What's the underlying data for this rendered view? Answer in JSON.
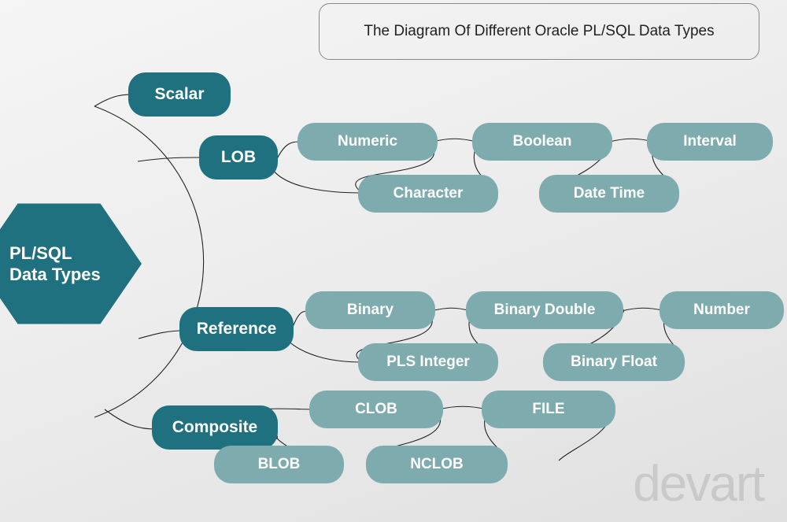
{
  "title": "The Diagram Of Different Oracle PL/SQL Data Types",
  "root": "PL/SQL\nData Types",
  "categories": {
    "scalar": "Scalar",
    "lob": "LOB",
    "reference": "Reference",
    "composite": "Composite"
  },
  "group1": {
    "numeric": "Numeric",
    "boolean": "Boolean",
    "interval": "Interval",
    "character": "Character",
    "datetime": "Date Time"
  },
  "group2": {
    "binary": "Binary",
    "binary_double": "Binary Double",
    "number": "Number",
    "pls_integer": "PLS Integer",
    "binary_float": "Binary Float"
  },
  "group3": {
    "clob": "CLOB",
    "file": "FILE",
    "blob": "BLOB",
    "nclob": "NCLOB"
  },
  "watermark": "devart"
}
